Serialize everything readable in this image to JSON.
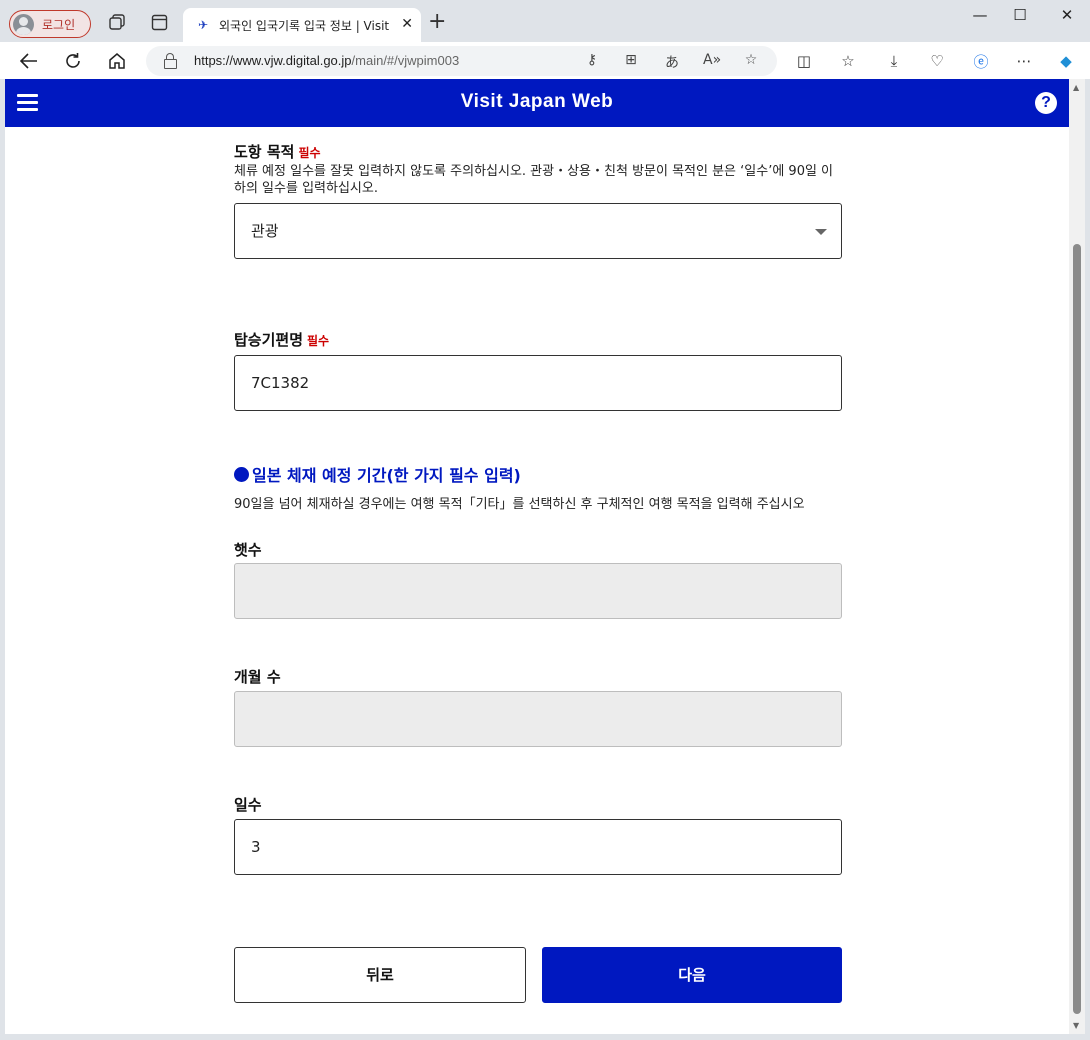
{
  "browser": {
    "profile_label": "로그인",
    "tab_title": "외국인 입국기록 입국 정보 | Visit",
    "url_main": "https://www.vjw.digital.go.jp",
    "url_path": "/main/#/vjwpim003"
  },
  "app": {
    "title": "Visit Japan Web",
    "help_label": "?"
  },
  "form": {
    "purpose": {
      "label": "도항 목적",
      "required": "필수",
      "note": "체류 예정 일수를 잘못 입력하지 않도록 주의하십시오. 관광・상용・친척 방문이 목적인 분은 ‘일수’에 90일 이하의 일수를 입력하십시오.",
      "value": "관광"
    },
    "flight": {
      "label": "탑승기편명",
      "required": "필수",
      "value": "7C1382"
    },
    "stay": {
      "section_title": "일본 체재 예정 기간(한 가지 필수 입력)",
      "note": "90일을 넘어 체재하실 경우에는 여행 목적「기타」를 선택하신 후 구체적인 여행 목적을 입력해 주십시오",
      "years_label": "햇수",
      "years_value": "",
      "months_label": "개월 수",
      "months_value": "",
      "days_label": "일수",
      "days_value": "3"
    },
    "back_label": "뒤로",
    "next_label": "다음"
  }
}
